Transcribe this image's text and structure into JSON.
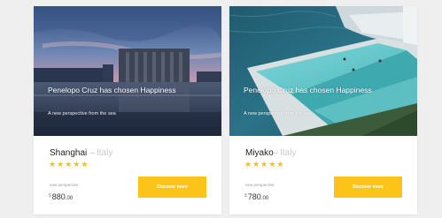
{
  "cards": [
    {
      "headline": "Penelopo Cruz has chosen Happiness",
      "tagline": "A new perspective from the sea",
      "city": "Shanghai",
      "country": "Italy",
      "rating": 5,
      "stars": [
        "★",
        "★",
        "★",
        "★",
        "★"
      ],
      "price_label": "new perspective",
      "currency": "$",
      "price_amount": "880",
      "price_cents": ".00",
      "button_label": "Discover more"
    },
    {
      "headline": "Penelopo Cruz has chosen Happiness",
      "tagline": "A new perspective from the sea",
      "city": "Miyako",
      "country": "Italy",
      "rating": 5,
      "stars": [
        "★",
        "★",
        "★",
        "★",
        "★"
      ],
      "price_label": "new perspective",
      "currency": "$",
      "price_amount": "780",
      "price_cents": ".00",
      "button_label": "Discover more"
    }
  ],
  "colors": {
    "accent": "#fcc419",
    "star": "#f5c400",
    "page_background": "#efefef"
  }
}
